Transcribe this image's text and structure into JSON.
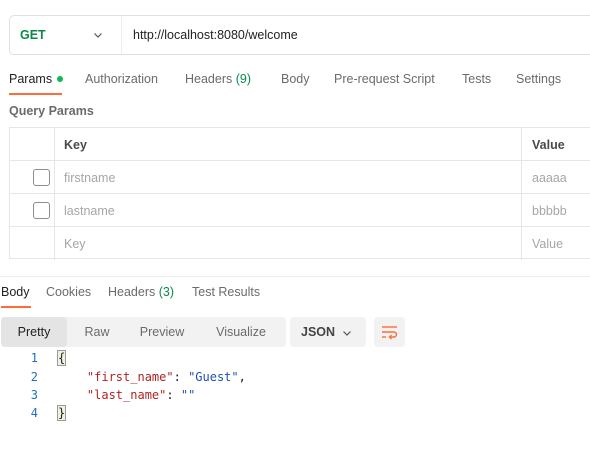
{
  "request": {
    "method": "GET",
    "url": "http://localhost:8080/welcome"
  },
  "request_tabs": [
    {
      "label": "Params",
      "active": true,
      "indicator": true
    },
    {
      "label": "Authorization"
    },
    {
      "label": "Headers",
      "count": "(9)"
    },
    {
      "label": "Body"
    },
    {
      "label": "Pre-request Script"
    },
    {
      "label": "Tests"
    },
    {
      "label": "Settings"
    }
  ],
  "query_params": {
    "title": "Query Params",
    "columns": {
      "key": "Key",
      "value": "Value"
    },
    "rows": [
      {
        "key": "firstname",
        "value": "aaaaa",
        "checked": false
      },
      {
        "key": "lastname",
        "value": "bbbbb",
        "checked": false
      }
    ],
    "placeholder": {
      "key": "Key",
      "value": "Value"
    }
  },
  "response_tabs": [
    {
      "label": "Body",
      "active": true
    },
    {
      "label": "Cookies"
    },
    {
      "label": "Headers",
      "count": "(3)"
    },
    {
      "label": "Test Results"
    }
  ],
  "view_modes": [
    {
      "label": "Pretty",
      "active": true
    },
    {
      "label": "Raw"
    },
    {
      "label": "Preview"
    },
    {
      "label": "Visualize"
    }
  ],
  "format": {
    "selected": "JSON"
  },
  "code_lines": [
    {
      "n": "1",
      "text": "{"
    },
    {
      "n": "2",
      "key": "\"first_name\"",
      "value": "\"Guest\"",
      "suffix": ","
    },
    {
      "n": "3",
      "key": "\"last_name\"",
      "value": "\"\"",
      "suffix": ""
    },
    {
      "n": "4",
      "text": "}"
    }
  ],
  "colors": {
    "accent": "#ff6c37",
    "method_get": "#0a8a4a",
    "indicator": "#0cbb52"
  },
  "icons": [
    "chevron-down-icon",
    "wrap-lines-icon"
  ]
}
